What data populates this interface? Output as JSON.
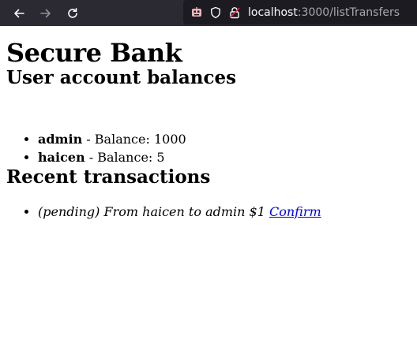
{
  "browser": {
    "url_host": "localhost",
    "url_rest": ":3000/listTransfers"
  },
  "page": {
    "title": "Secure Bank",
    "balances_heading": "User account balances",
    "balance_label": " - Balance: ",
    "accounts": [
      {
        "name": "admin",
        "balance": "1000"
      },
      {
        "name": "haicen",
        "balance": "5"
      }
    ],
    "transactions_heading": "Recent transactions",
    "transactions": [
      {
        "text": "(pending) From haicen to admin $1",
        "link_label": "Confirm"
      }
    ]
  }
}
